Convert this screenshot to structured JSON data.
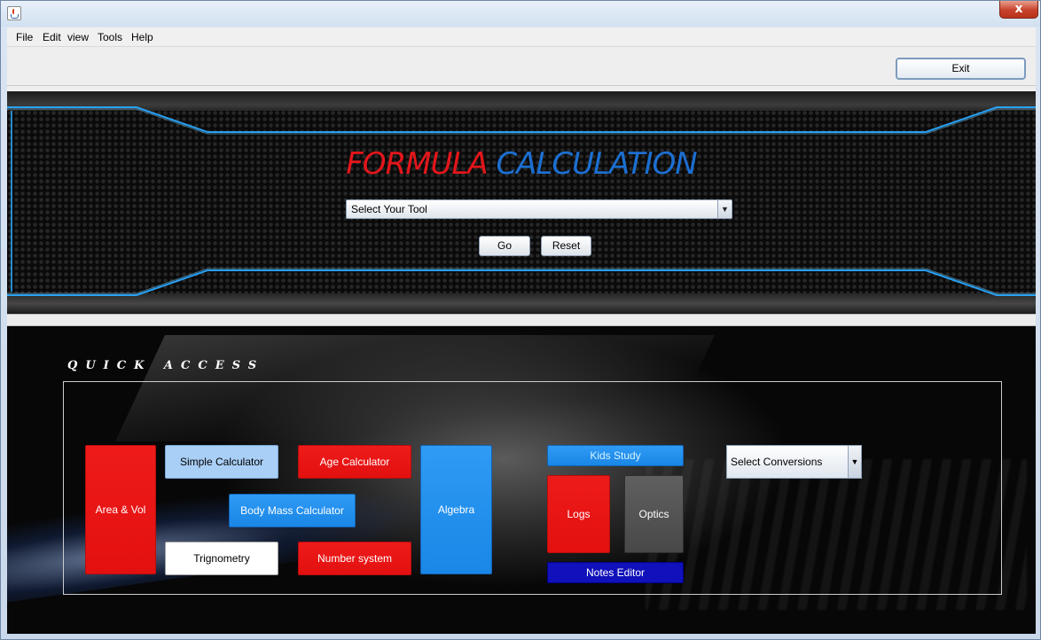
{
  "window": {
    "close_glyph": "x"
  },
  "menu": [
    "File",
    "Edit",
    "view",
    "Tools",
    "Help"
  ],
  "toolbar": {
    "exit_label": "Exit"
  },
  "header": {
    "title_part1": "FORMULA",
    "title_part2": "CALCULATION",
    "tool_select_value": "Select Your Tool",
    "go_label": "Go",
    "reset_label": "Reset"
  },
  "quick_access": {
    "label": "QUICK ACCESS",
    "tiles": {
      "area_vol": "Area & Vol",
      "simple_calculator": "Simple Calculator",
      "age_calculator": "Age Calculator",
      "body_mass_calculator": "Body Mass Calculator",
      "trignometry": "Trignometry",
      "number_system": "Number system",
      "algebra": "Algebra",
      "kids_study": "Kids Study",
      "logs": "Logs",
      "optics": "Optics",
      "notes_editor": "Notes Editor"
    },
    "conversions_select_value": "Select Conversions"
  },
  "colors": {
    "title_red": "#e3161b",
    "title_blue": "#1c6fd1",
    "tile_red": "#e31010",
    "tile_blue": "#1a86e6",
    "notes_navy": "#1111bb",
    "neon_cyan": "#2aa8ff"
  },
  "icons": {
    "app": "java-cup-icon",
    "dropdown": "chevron-down-icon"
  }
}
